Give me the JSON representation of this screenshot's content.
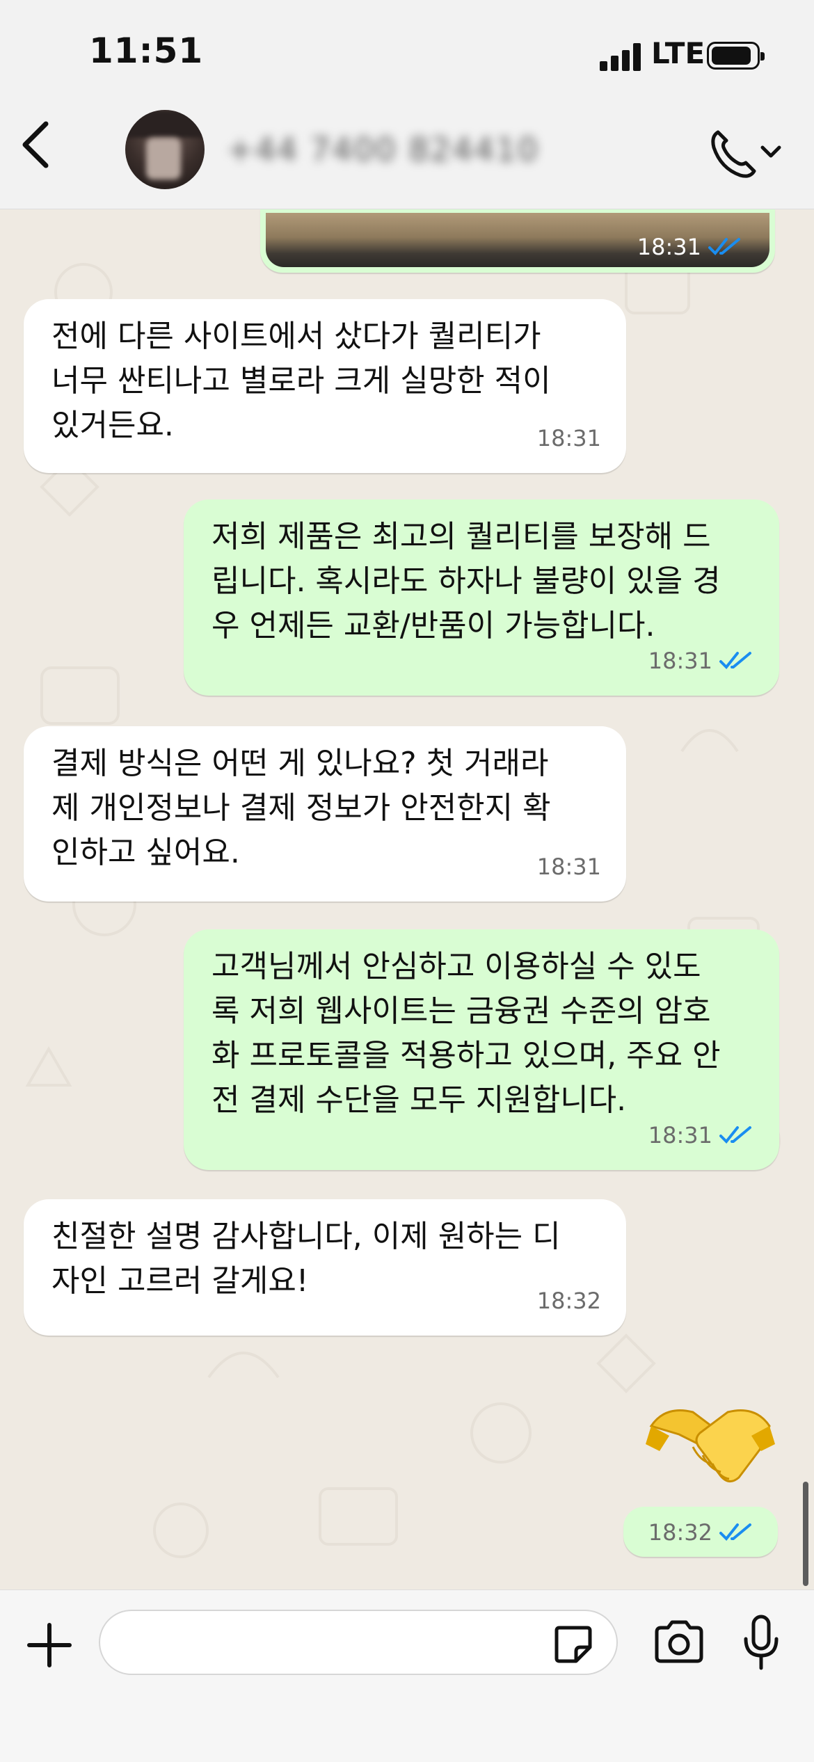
{
  "status_bar": {
    "time": "11:51",
    "network": "LTE"
  },
  "header": {
    "contact_name": "+44 7400 824410"
  },
  "messages": [
    {
      "id": 0,
      "direction": "out",
      "kind": "image",
      "time": "18:31",
      "read": true
    },
    {
      "id": 1,
      "direction": "in",
      "text": "전에 다른 사이트에서 샀다가 퀄리티가\n너무 싼티나고 별로라 크게 실망한 적이\n있거든요.",
      "time": "18:31"
    },
    {
      "id": 2,
      "direction": "out",
      "text": "저희 제품은 최고의 퀄리티를 보장해 드\n립니다. 혹시라도 하자나 불량이 있을 경\n우 언제든 교환/반품이 가능합니다.",
      "time": "18:31",
      "read": true
    },
    {
      "id": 3,
      "direction": "in",
      "text": "결제 방식은 어떤 게 있나요? 첫 거래라\n제 개인정보나 결제 정보가 안전한지 확\n인하고 싶어요.",
      "time": "18:31"
    },
    {
      "id": 4,
      "direction": "out",
      "text": "고객님께서 안심하고 이용하실 수 있도\n록 저희 웹사이트는 금융권 수준의 암호\n화 프로토콜을 적용하고 있으며, 주요 안\n전 결제 수단을 모두 지원합니다.",
      "time": "18:31",
      "read": true
    },
    {
      "id": 5,
      "direction": "in",
      "text": "친절한 설명 감사합니다, 이제 원하는 디\n자인 고르러 갈게요!",
      "time": "18:32"
    },
    {
      "id": 6,
      "direction": "out",
      "kind": "emoji",
      "emoji": "handshake",
      "time": "18:32",
      "read": true
    }
  ],
  "input": {
    "placeholder": ""
  },
  "icons": {
    "back": "chevron-left-icon",
    "call": "phone-icon",
    "attach": "plus-icon",
    "sticker": "sticker-icon",
    "camera": "camera-icon",
    "mic": "microphone-icon",
    "read_receipt": "double-check-icon"
  },
  "colors": {
    "incoming_bubble": "#ffffff",
    "outgoing_bubble": "#d9fdd3",
    "read_tick": "#1a8df0",
    "chat_background": "#efeae2"
  }
}
